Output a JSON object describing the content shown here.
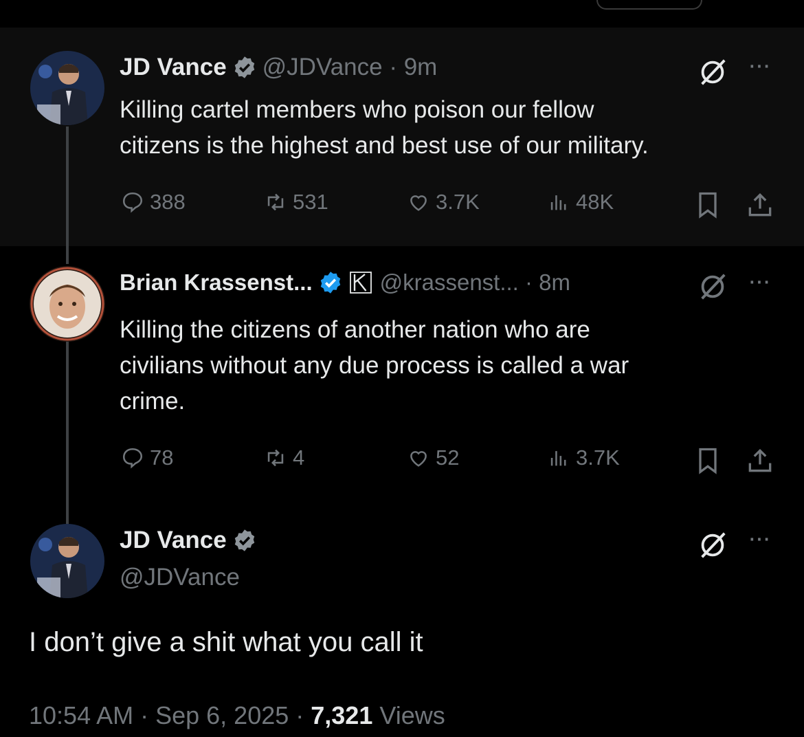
{
  "tweet1": {
    "name": "JD Vance",
    "handle": "@JDVance · 9m",
    "text_line1": "Killing cartel members who poison our fellow",
    "text_line2": "citizens is the highest and best use of our military.",
    "replies": "388",
    "retweets": "531",
    "likes": "3.7K",
    "views": "48K"
  },
  "tweet2": {
    "name": "Brian Krassenst...",
    "handle": "@krassenst... · 8m",
    "text_line1": "Killing the citizens of another nation who are",
    "text_line2": "civilians without any due process is called a war",
    "text_line3": "crime.",
    "replies": "78",
    "retweets": "4",
    "likes": "52",
    "views": "3.7K"
  },
  "tweet3": {
    "name": "JD Vance",
    "handle": "@JDVance",
    "text": "I don’t give a shit what you call it",
    "time": "10:54 AM · Sep 6, 2025 · ",
    "views_count": "7,321",
    "views_label": " Views"
  },
  "icons": {
    "reply": "reply-icon",
    "retweet": "retweet-icon",
    "like": "heart-icon",
    "views": "views-icon",
    "bookmark": "bookmark-icon",
    "share": "share-icon",
    "grok": "grok-icon",
    "more": "more-icon",
    "verified": "verified-badge-icon"
  },
  "more_glyph": "···",
  "colors": {
    "background": "#000000",
    "highlight": "#0d0d0d",
    "text": "#e7e9ea",
    "muted": "#71767b",
    "verified": "#1d9bf0"
  }
}
